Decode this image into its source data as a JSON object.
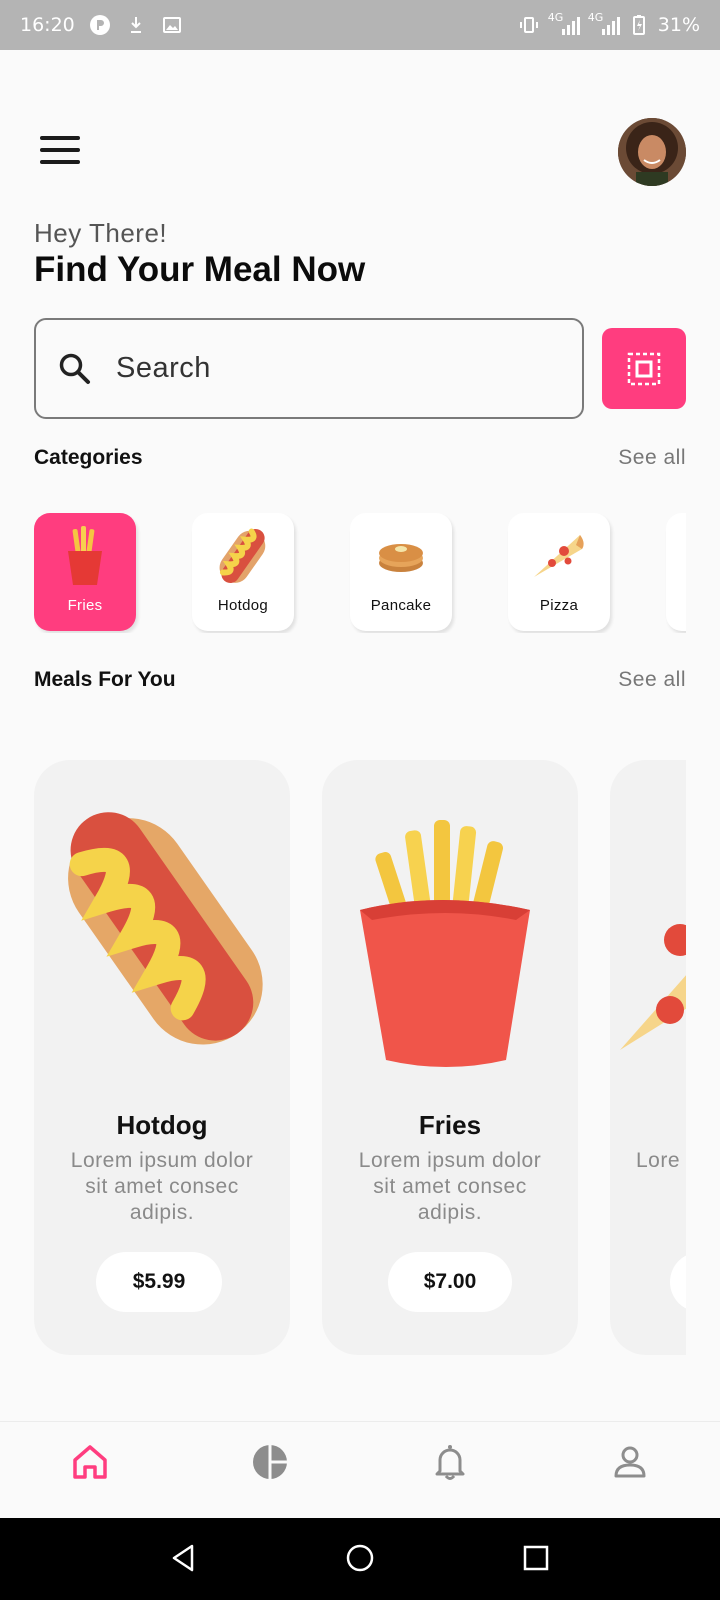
{
  "status_bar": {
    "time": "16:20",
    "network_1": "4G",
    "network_2": "4G",
    "battery": "31%"
  },
  "header": {
    "greeting": "Hey There!",
    "title": "Find Your Meal Now"
  },
  "search": {
    "placeholder": "Search"
  },
  "categories": {
    "title": "Categories",
    "see_all": "See all",
    "items": [
      {
        "label": "Fries",
        "active": true
      },
      {
        "label": "Hotdog",
        "active": false
      },
      {
        "label": "Pancake",
        "active": false
      },
      {
        "label": "Pizza",
        "active": false
      }
    ]
  },
  "meals": {
    "title": "Meals For You",
    "see_all": "See all",
    "items": [
      {
        "name": "Hotdog",
        "description": "Lorem ipsum dolor sit amet consec adipis.",
        "price": "$5.99"
      },
      {
        "name": "Fries",
        "description": "Lorem ipsum dolor sit amet consec adipis.",
        "price": "$7.00"
      },
      {
        "name": "",
        "description": "Lore sit",
        "price": ""
      }
    ]
  },
  "bottom_nav": {
    "items": [
      "home-icon",
      "pie-chart-icon",
      "bell-icon",
      "profile-icon"
    ],
    "active": "home-icon"
  },
  "colors": {
    "accent": "#ff3d7f",
    "status_bar": "#b4b4b4",
    "card_bg": "#f2f2f2"
  }
}
